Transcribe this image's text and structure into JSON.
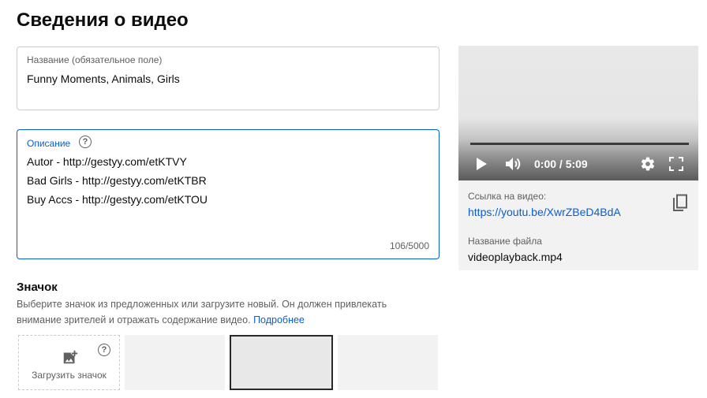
{
  "page": {
    "title": "Сведения о видео"
  },
  "title_field": {
    "label": "Название (обязательное поле)",
    "value": "Funny Moments, Animals, Girls"
  },
  "description_field": {
    "label": "Описание",
    "help": "?",
    "lines": [
      "Autor - http://gestyy.com/etKTVY",
      "Bad Girls - http://gestyy.com/etKTBR",
      "Buy Accs - http://gestyy.com/etKTOU"
    ],
    "char_count": "106/5000"
  },
  "thumbnail": {
    "heading": "Значок",
    "description": "Выберите значок из предложенных или загрузите новый. Он должен привлекать внимание зрителей и отражать содержание видео.",
    "more_link": "Подробнее",
    "upload_label": "Загрузить значок",
    "help": "?"
  },
  "video": {
    "time": "0:00 / 5:09",
    "link_label": "Ссылка на видео:",
    "link": "https://youtu.be/XwrZBeD4BdA",
    "file_label": "Название файла",
    "file_name": "videoplayback.mp4"
  },
  "colors": {
    "accent": "#065fd4",
    "panel_bg": "#f2f2f2",
    "selected_border": "#282828"
  },
  "icons": {
    "play": "play-icon",
    "volume": "volume-icon",
    "settings": "gear-icon",
    "fullscreen": "fullscreen-icon",
    "copy": "copy-icon",
    "upload": "add-image-icon",
    "help": "help-icon"
  }
}
